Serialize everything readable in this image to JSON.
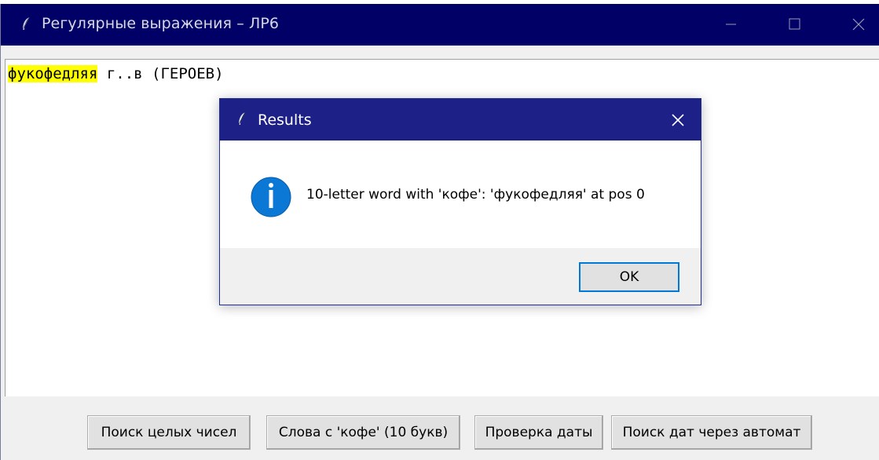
{
  "window": {
    "title": "Регулярные выражения – ЛР6",
    "controls": [
      "minimize-icon",
      "maximize-icon",
      "close-icon"
    ]
  },
  "text_area": {
    "highlighted": "фукофедляя",
    "rest": " г..в (ГЕРОЕВ)",
    "highlight_color": "#ffff00"
  },
  "buttons": {
    "find_integers": "Поиск целых чисел",
    "kofe_words": "Слова с 'кофе' (10 букв)",
    "check_date": "Проверка даты",
    "automaton_dates": "Поиск дат через автомат"
  },
  "dialog": {
    "title": "Results",
    "message": "10-letter word with 'кофе': 'фукофедляя' at pos 0",
    "ok_label": "OK",
    "icon": "info-icon",
    "accent": "#0078d7",
    "titlebar_color": "#1c2087"
  },
  "colors": {
    "main_titlebar": "#000066"
  }
}
